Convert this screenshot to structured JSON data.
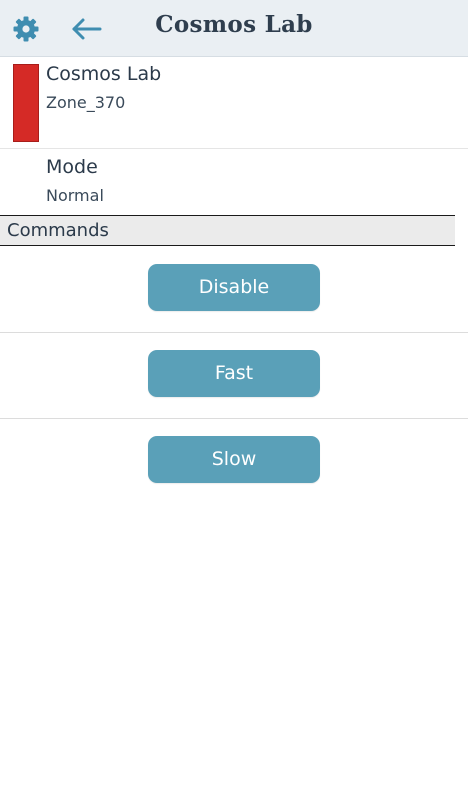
{
  "header": {
    "title": "Cosmos Lab",
    "settings_icon": "gear-icon",
    "back_icon": "arrow-left-icon",
    "icon_color": "#3f8db0"
  },
  "device": {
    "name": "Cosmos Lab",
    "zone": "Zone_370",
    "status_color": "#d52a26"
  },
  "mode": {
    "label": "Mode",
    "value": "Normal"
  },
  "commands": {
    "section_label": "Commands",
    "buttons": [
      {
        "label": "Disable"
      },
      {
        "label": "Fast"
      },
      {
        "label": "Slow"
      }
    ],
    "button_color": "#5aa0b8"
  }
}
